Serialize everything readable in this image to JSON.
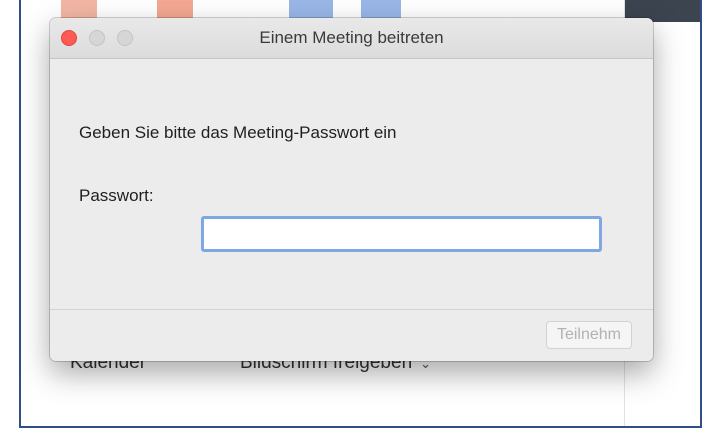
{
  "background_app": {
    "calendar_label": "Kalender",
    "share_screen_label": "Bildschirm freigeben",
    "share_screen_chevron": "chevron-down-icon"
  },
  "dialog": {
    "title": "Einem Meeting beitreten",
    "window_controls": [
      "close",
      "minimize",
      "zoom"
    ],
    "prompt": "Geben Sie bitte das Meeting-Passwort ein",
    "password_label": "Passwort:",
    "password_value": "",
    "join_button_label": "Teilnehm",
    "join_button_enabled": false,
    "colors": {
      "close_button": "#fd5b54",
      "input_focus_ring": "#7fa7e3",
      "disabled_text": "#b2b2b2"
    }
  }
}
